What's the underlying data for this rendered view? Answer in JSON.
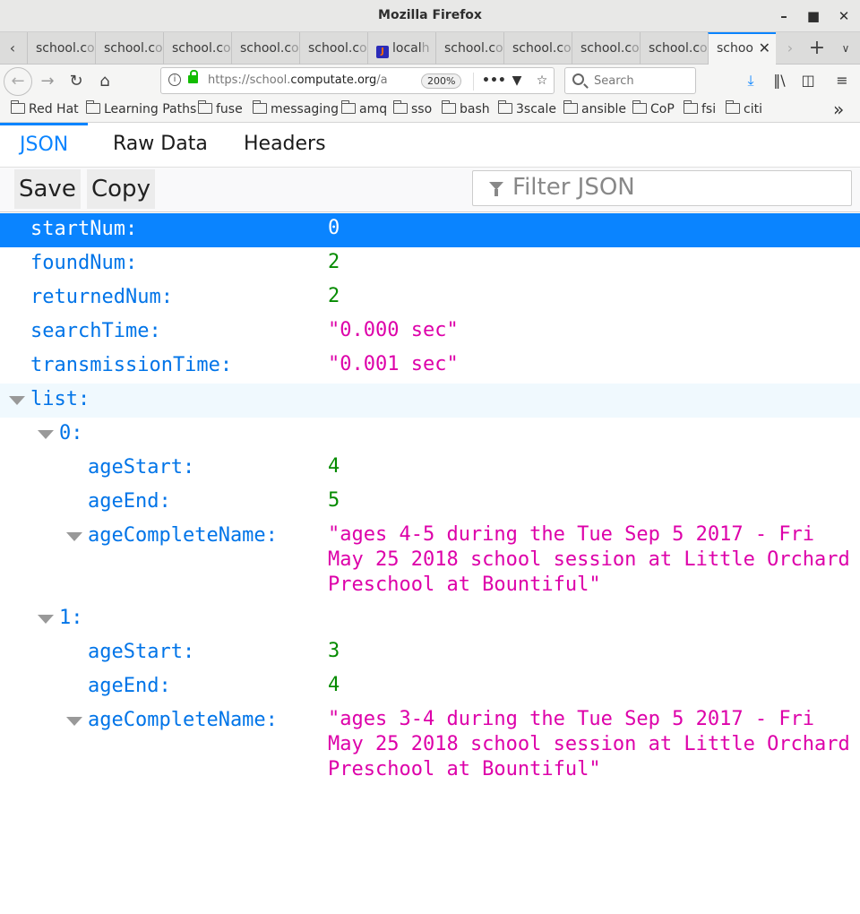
{
  "window": {
    "title": "Mozilla Firefox"
  },
  "tabs": [
    {
      "label": "school.c",
      "fade": "o"
    },
    {
      "label": "school.c",
      "fade": "o"
    },
    {
      "label": "school.c",
      "fade": "o"
    },
    {
      "label": "school.c",
      "fade": "o"
    },
    {
      "label": "school.c",
      "fade": "o"
    },
    {
      "label": "local",
      "fade": "h"
    },
    {
      "label": "school.c",
      "fade": "o"
    },
    {
      "label": "school.c",
      "fade": "o"
    },
    {
      "label": "school.c",
      "fade": "o"
    },
    {
      "label": "school.c",
      "fade": "o"
    },
    {
      "label": "schoo",
      "fade": ""
    }
  ],
  "navbar": {
    "url_prefix": "https://school.",
    "url_domain": "computate.org",
    "url_suffix": "/a",
    "zoom": "200%",
    "search_placeholder": "Search"
  },
  "bookmarks": [
    "Red Hat",
    "Learning Paths",
    "fuse",
    "messaging",
    "amq",
    "sso",
    "bash",
    "3scale",
    "ansible",
    "CoP",
    "fsi",
    "citi"
  ],
  "viewer": {
    "tabs": [
      "JSON",
      "Raw Data",
      "Headers"
    ],
    "save_label": "Save",
    "copy_label": "Copy",
    "filter_placeholder": "Filter JSON"
  },
  "json": {
    "startNum": {
      "key": "startNum:",
      "value": "0"
    },
    "foundNum": {
      "key": "foundNum:",
      "value": "2"
    },
    "returnedNum": {
      "key": "returnedNum:",
      "value": "2"
    },
    "searchTime": {
      "key": "searchTime:",
      "value": "\"0.000 sec\""
    },
    "transmissionTime": {
      "key": "transmissionTime:",
      "value": "\"0.001 sec\""
    },
    "list_key": "list:",
    "items": [
      {
        "index": "0:",
        "ageStart_key": "ageStart:",
        "ageStart": "4",
        "ageEnd_key": "ageEnd:",
        "ageEnd": "5",
        "ageCompleteName_key": "ageCompleteName:",
        "ageCompleteName": "\"ages 4-5 during the Tue Sep 5 2017 - Fri May 25 2018 school session at Little Orchard Preschool at Bountiful\""
      },
      {
        "index": "1:",
        "ageStart_key": "ageStart:",
        "ageStart": "3",
        "ageEnd_key": "ageEnd:",
        "ageEnd": "4",
        "ageCompleteName_key": "ageCompleteName:",
        "ageCompleteName": "\"ages 3-4 during the Tue Sep 5 2017 - Fri May 25 2018 school session at Little Orchard Preschool at Bountiful\""
      }
    ]
  }
}
